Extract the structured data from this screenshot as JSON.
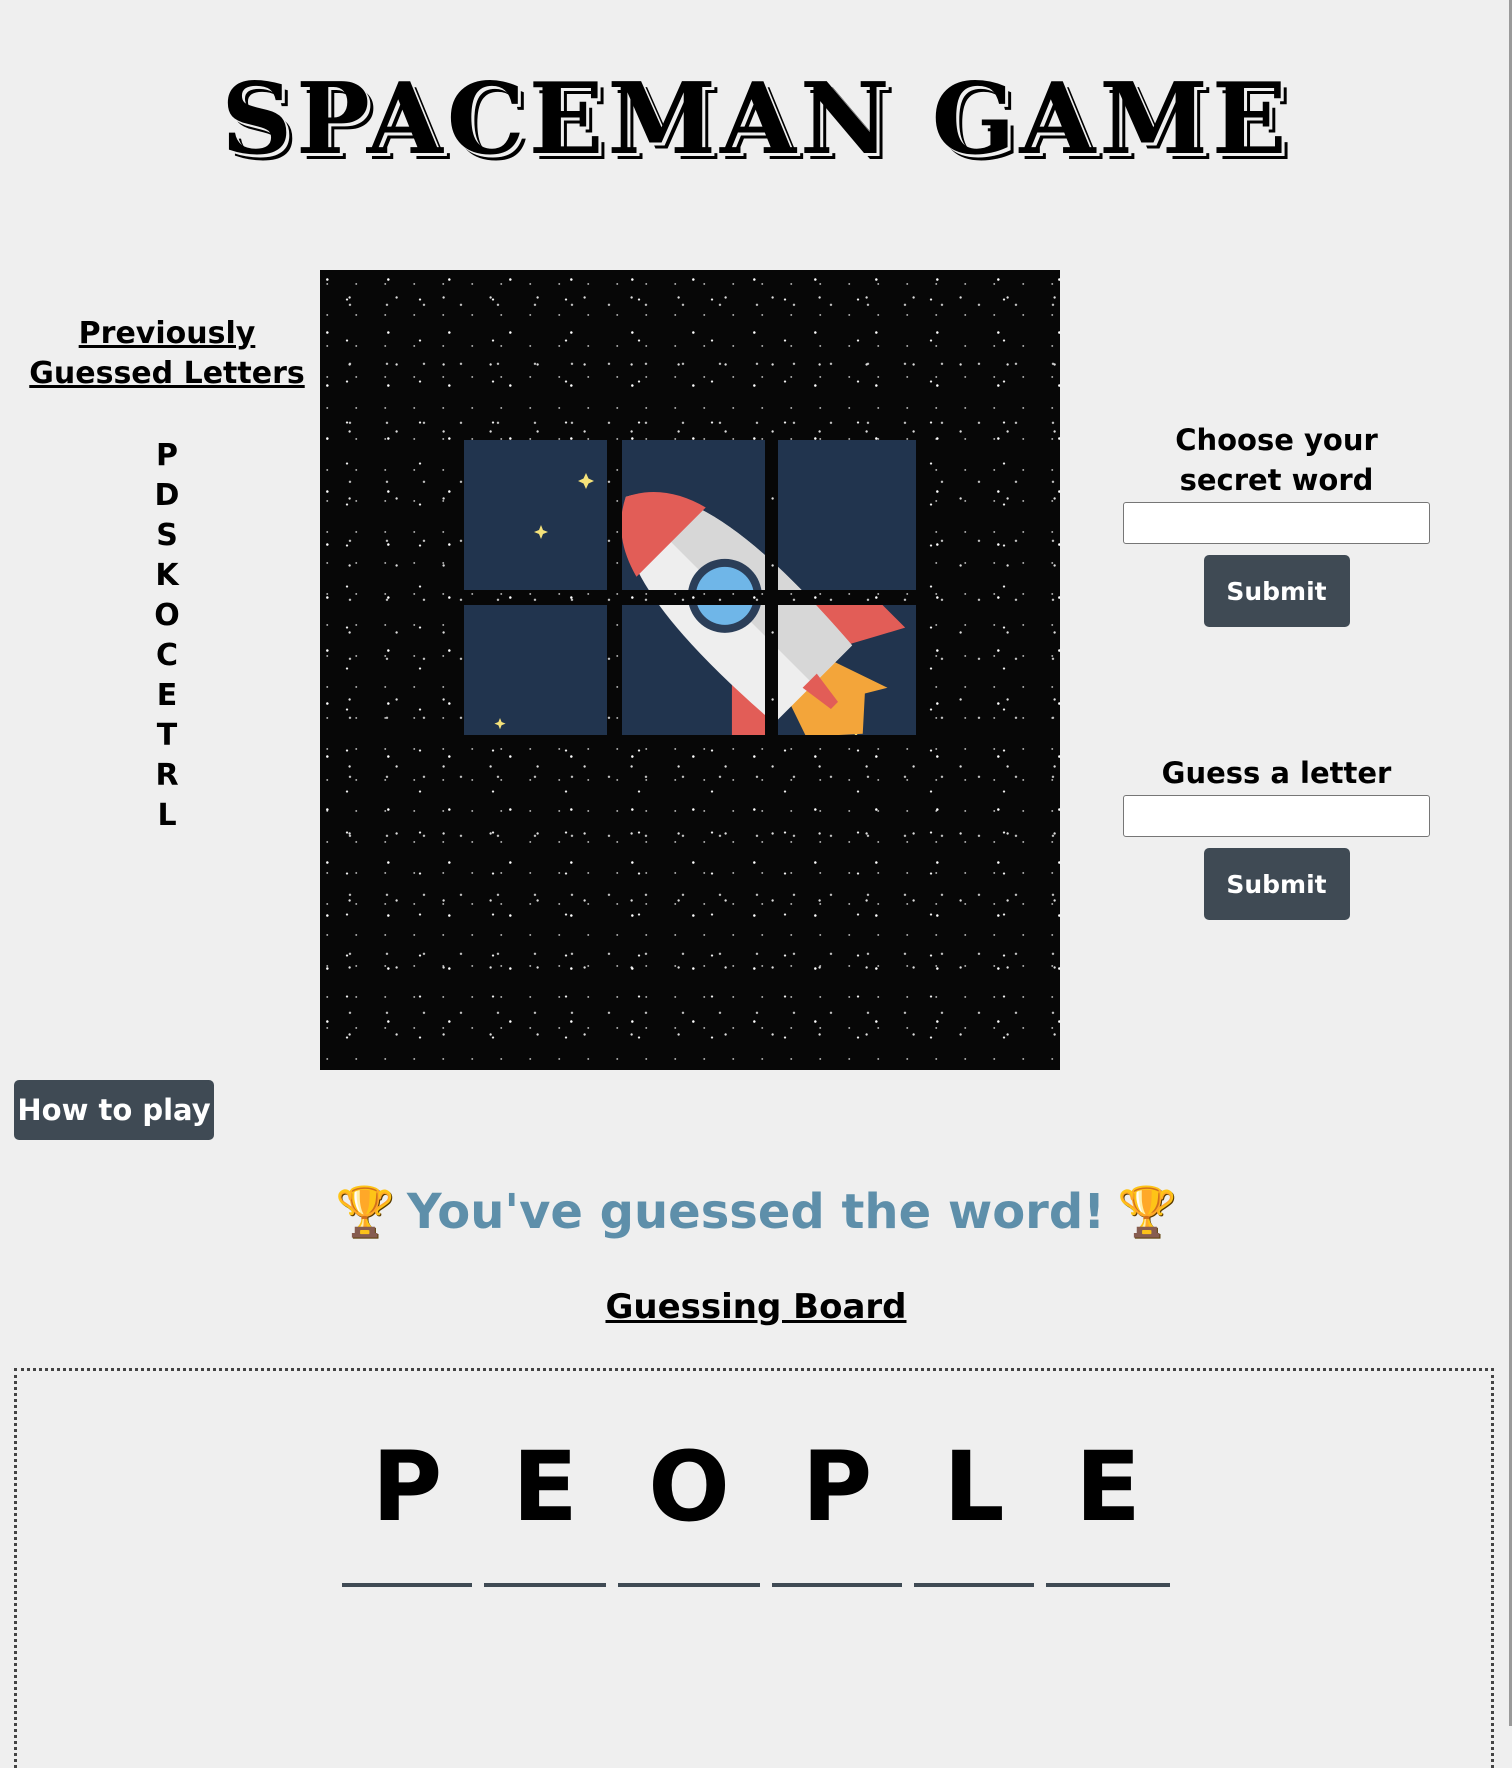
{
  "title": "SPACEMAN GAME",
  "previously_guessed": {
    "heading": "Previously Guessed Letters",
    "letters": [
      "P",
      "D",
      "S",
      "K",
      "O",
      "C",
      "E",
      "T",
      "R",
      "L"
    ]
  },
  "secret_word": {
    "label": "Choose your secret word",
    "value": "",
    "submit_label": "Submit"
  },
  "guess_letter": {
    "label": "Guess a letter",
    "value": "",
    "submit_label": "Submit"
  },
  "how_to_play_label": "How to play",
  "win_message": "You've guessed the word!",
  "trophy_glyph": "🏆",
  "board": {
    "heading": "Guessing Board",
    "letters": [
      "P",
      "E",
      "O",
      "P",
      "L",
      "E"
    ]
  },
  "colors": {
    "background": "#efefef",
    "button": "#3f4a54",
    "win_text": "#5e8faa",
    "tile": "#21344e",
    "rocket_red": "#e25d57",
    "rocket_window": "#6fb6e8"
  },
  "icons": {
    "trophy": "trophy-icon",
    "rocket": "rocket-icon"
  }
}
